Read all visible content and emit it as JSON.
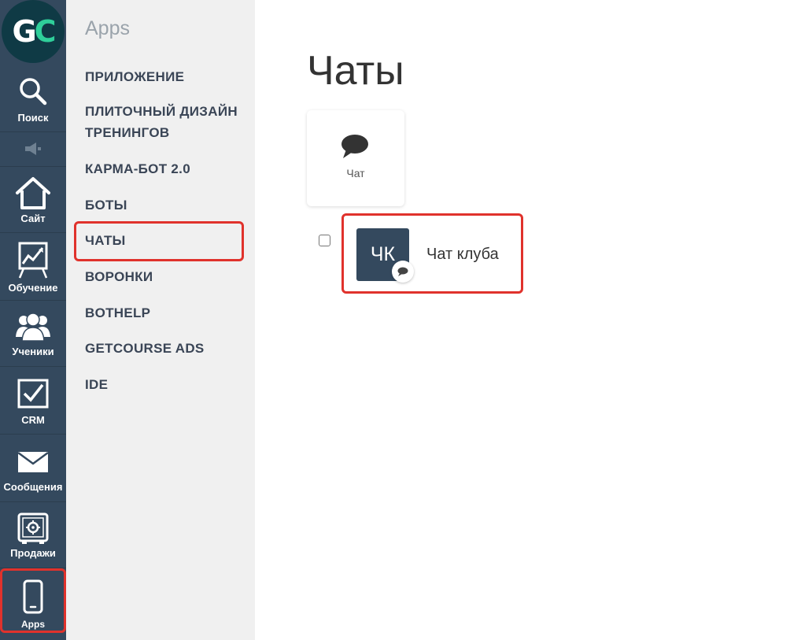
{
  "rail": {
    "logo_left": "G",
    "logo_right": "C",
    "items": [
      {
        "label": "Поиск",
        "icon": "search-icon"
      },
      {
        "label": "",
        "icon": "speaker-icon"
      },
      {
        "label": "Сайт",
        "icon": "home-icon"
      },
      {
        "label": "Обучение",
        "icon": "chart-board-icon"
      },
      {
        "label": "Ученики",
        "icon": "users-icon"
      },
      {
        "label": "CRM",
        "icon": "checkbox-icon"
      },
      {
        "label": "Сообщения",
        "icon": "envelope-icon"
      },
      {
        "label": "Продажи",
        "icon": "safe-icon"
      },
      {
        "label": "Apps",
        "icon": "phone-icon"
      }
    ]
  },
  "submenu": {
    "title": "Apps",
    "items": [
      {
        "label": "ПРИЛОЖЕНИЕ"
      },
      {
        "label": "ПЛИТОЧНЫЙ ДИЗАЙН ТРЕНИНГОВ"
      },
      {
        "label": "КАРМА-БОТ 2.0"
      },
      {
        "label": "БОТЫ"
      },
      {
        "label": "ЧАТЫ"
      },
      {
        "label": "ВОРОНКИ"
      },
      {
        "label": "BOTHELP"
      },
      {
        "label": "GETCOURSE ADS"
      },
      {
        "label": "IDE"
      }
    ],
    "active": "ЧАТЫ"
  },
  "main": {
    "title": "Чаты",
    "tile": {
      "label": "Чат",
      "icon": "chat-bubble-icon"
    },
    "chats": [
      {
        "initials": "ЧК",
        "name": "Чат клуба",
        "badge_icon": "chat-bubble-icon"
      }
    ]
  },
  "colors": {
    "rail_bg": "#34495e",
    "submenu_bg": "#f0f0f0",
    "highlight": "#e0322c",
    "logo_accent": "#2fcf9a"
  }
}
